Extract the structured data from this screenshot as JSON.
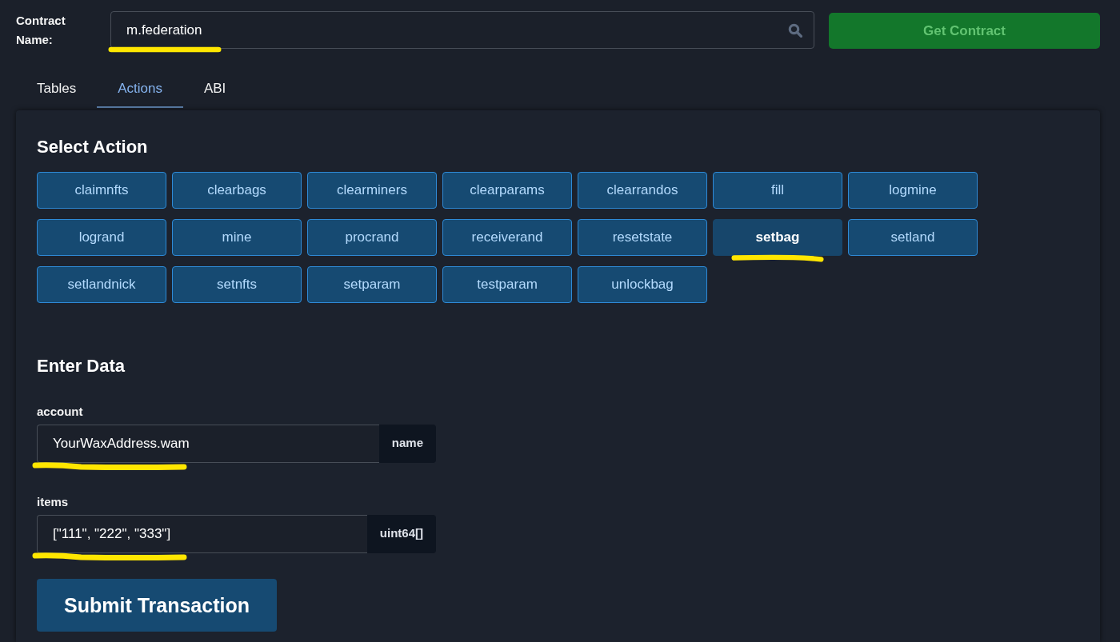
{
  "contract": {
    "label": "Contract Name:",
    "value": "m.federation",
    "highlighted": true,
    "button": "Get Contract"
  },
  "tabs": [
    {
      "label": "Tables",
      "selected": false
    },
    {
      "label": "Actions",
      "selected": true
    },
    {
      "label": "ABI",
      "selected": false
    }
  ],
  "actions": {
    "title": "Select Action",
    "items": [
      {
        "label": "claimnfts",
        "selected": false,
        "highlighted": false
      },
      {
        "label": "clearbags",
        "selected": false,
        "highlighted": false
      },
      {
        "label": "clearminers",
        "selected": false,
        "highlighted": false
      },
      {
        "label": "clearparams",
        "selected": false,
        "highlighted": false
      },
      {
        "label": "clearrandos",
        "selected": false,
        "highlighted": false
      },
      {
        "label": "fill",
        "selected": false,
        "highlighted": false
      },
      {
        "label": "logmine",
        "selected": false,
        "highlighted": false
      },
      {
        "label": "logrand",
        "selected": false,
        "highlighted": false
      },
      {
        "label": "mine",
        "selected": false,
        "highlighted": false
      },
      {
        "label": "procrand",
        "selected": false,
        "highlighted": false
      },
      {
        "label": "receiverand",
        "selected": false,
        "highlighted": false
      },
      {
        "label": "resetstate",
        "selected": false,
        "highlighted": false
      },
      {
        "label": "setbag",
        "selected": true,
        "highlighted": true
      },
      {
        "label": "setland",
        "selected": false,
        "highlighted": false
      },
      {
        "label": "setlandnick",
        "selected": false,
        "highlighted": false
      },
      {
        "label": "setnfts",
        "selected": false,
        "highlighted": false
      },
      {
        "label": "setparam",
        "selected": false,
        "highlighted": false
      },
      {
        "label": "testparam",
        "selected": false,
        "highlighted": false
      },
      {
        "label": "unlockbag",
        "selected": false,
        "highlighted": false
      }
    ]
  },
  "data": {
    "title": "Enter Data",
    "fields": [
      {
        "label": "account",
        "value": "YourWaxAddress.wam",
        "data_type": "name",
        "highlighted": true
      },
      {
        "label": "items",
        "value": "[\"111\", \"222\", \"333\"]",
        "data_type": "uint64[]",
        "highlighted": true
      }
    ]
  },
  "submit": "Submit Transaction"
}
